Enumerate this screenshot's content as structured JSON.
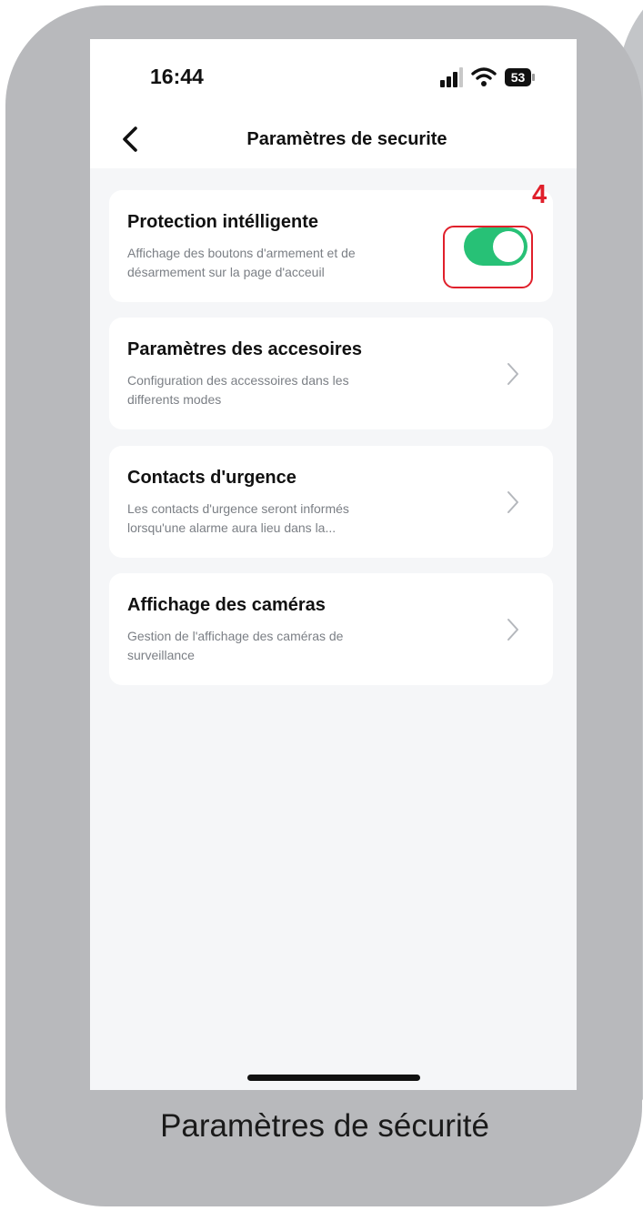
{
  "status_bar": {
    "time": "16:44",
    "battery": "53",
    "icons": [
      "signal-icon",
      "wifi-icon",
      "battery-icon"
    ]
  },
  "nav": {
    "back_icon": "chevron-left-icon",
    "title": "Paramètres de securite"
  },
  "settings": [
    {
      "title": "Protection intélligente",
      "description_line1": "Affichage des boutons d'armement et de",
      "description_line2": "désarmement sur la page d'acceuil",
      "control": "toggle",
      "toggle_on": true
    },
    {
      "title": "Paramètres des accesoires",
      "description_line1": "Configuration des accessoires dans les",
      "description_line2": "differents modes",
      "control": "chevron-right-icon"
    },
    {
      "title": "Contacts d'urgence",
      "description_line1": "Les contacts d'urgence seront informés",
      "description_line2": "lorsqu'une alarme aura lieu dans la...",
      "control": "chevron-right-icon"
    },
    {
      "title": "Affichage des caméras",
      "description_line1": "Gestion de l'affichage des caméras de",
      "description_line2": "surveillance",
      "control": "chevron-right-icon"
    }
  ],
  "annotation": {
    "step_number": "4",
    "color": "#e0202b"
  },
  "caption": "Paramètres de sécurité",
  "colors": {
    "toggle_on": "#27c176",
    "frame": "#b8b9bc",
    "screen_background": "#f5f6f8"
  }
}
